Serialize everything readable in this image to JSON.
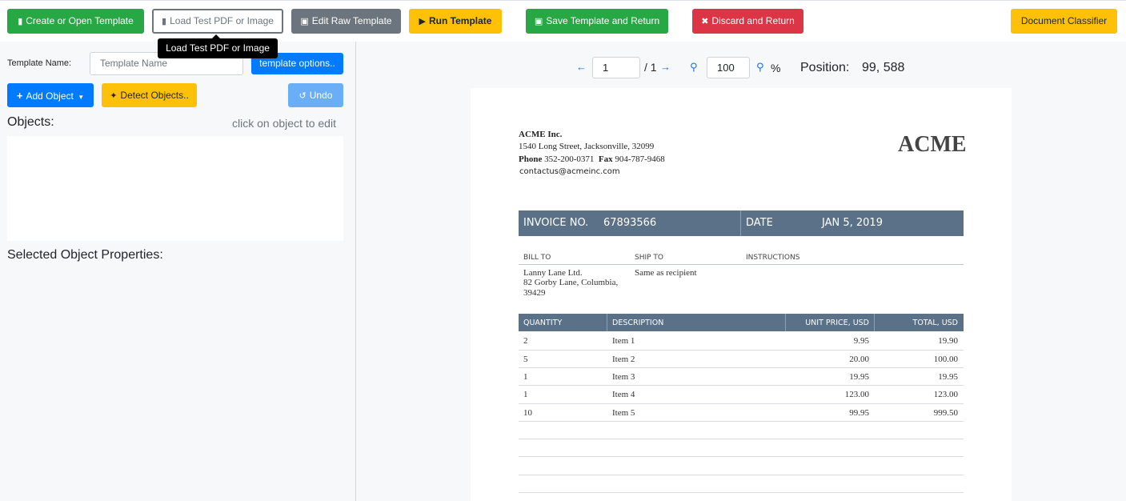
{
  "toolbar": {
    "create_open": "Create or Open Template",
    "load_test": "Load Test PDF or Image",
    "edit_raw": "Edit Raw Template",
    "run": "Run Template",
    "save_return": "Save Template and Return",
    "discard_return": "Discard and Return",
    "doc_classifier": "Document Classifier"
  },
  "tooltip": "Load Test PDF or Image",
  "left": {
    "template_name_label": "Template Name:",
    "template_name_placeholder": "Template Name",
    "template_options": "template options..",
    "add_object": "Add Object",
    "detect_objects": "Detect Objects..",
    "undo": "Undo",
    "objects_heading": "Objects:",
    "objects_hint": "click on object to edit",
    "selected_props_heading": "Selected Object Properties:"
  },
  "viewer": {
    "page_current": "1",
    "page_total": "/ 1",
    "zoom": "100",
    "zoom_unit": "%",
    "position_label": "Position:",
    "position_value": "99, 588"
  },
  "invoice": {
    "company": "ACME Inc.",
    "address": "1540  Long Street, Jacksonville, 32099",
    "phone_label": "Phone",
    "phone": "352-200-0371",
    "fax_label": "Fax",
    "fax": "904-787-9468",
    "email": "contactus@acmeinc.com",
    "logo": "ACME",
    "invoice_no_label": "INVOICE NO.",
    "invoice_no": "67893566",
    "date_label": "DATE",
    "date": "JAN 5, 2019",
    "bill_to_label": "BILL TO",
    "ship_to_label": "SHIP TO",
    "instructions_label": "INSTRUCTIONS",
    "bill_to": [
      "Lanny Lane Ltd.",
      "82  Gorby Lane, Columbia,",
      "39429"
    ],
    "ship_to": "Same as recipient",
    "columns": [
      "QUANTITY",
      "DESCRIPTION",
      "UNIT PRICE, USD",
      "TOTAL, USD"
    ],
    "rows": [
      [
        "2",
        "Item 1",
        "9.95",
        "19.90"
      ],
      [
        "5",
        "Item 2",
        "20.00",
        "100.00"
      ],
      [
        "1",
        "Item 3",
        "19.95",
        "19.95"
      ],
      [
        "1",
        "Item 4",
        "123.00",
        "123.00"
      ],
      [
        "10",
        "Item 5",
        "99.95",
        "999.50"
      ]
    ]
  },
  "colors": {
    "green": "#28a745",
    "blue": "#007bff",
    "yellow": "#ffc107",
    "red": "#dc3545",
    "gray": "#6c757d",
    "invoice_bar": "#5a7188"
  },
  "icons": {
    "create_open": "file-icon",
    "load_test": "file-pdf-icon",
    "edit_raw": "save-icon",
    "run": "play-icon",
    "save_return": "save-icon",
    "discard_return": "close-icon",
    "add_object": "plus-icon",
    "detect_objects": "magic-wand-icon",
    "undo": "undo-icon",
    "prev_page": "arrow-left-icon",
    "next_page": "arrow-right-icon",
    "zoom_out": "zoom-out-icon",
    "zoom_in": "zoom-in-icon"
  }
}
